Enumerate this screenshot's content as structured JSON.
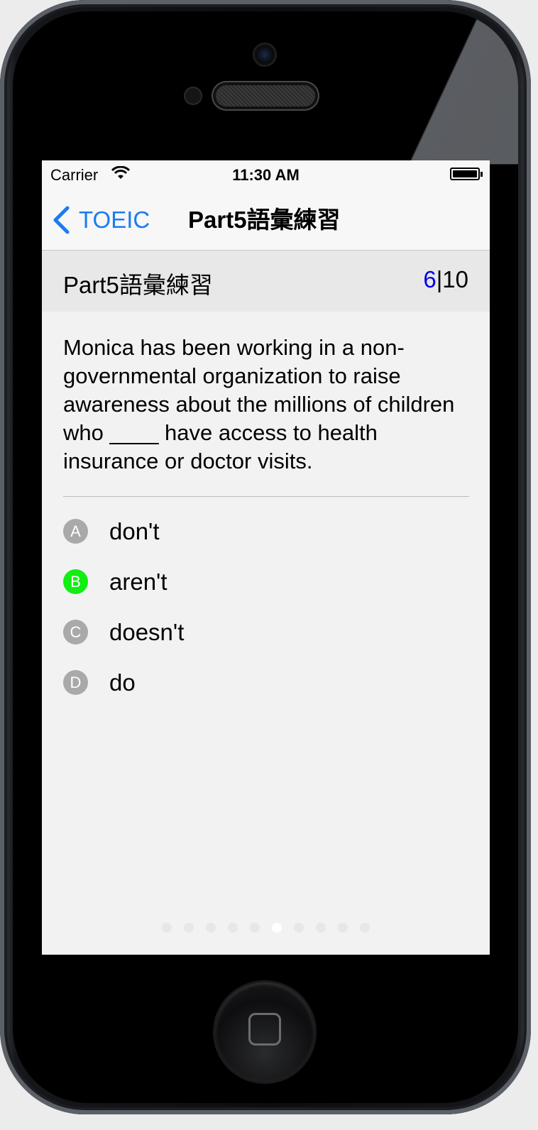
{
  "status_bar": {
    "carrier": "Carrier",
    "time": "11:30 AM"
  },
  "nav": {
    "back_label": "TOEIC",
    "title": "Part5語彙練習"
  },
  "header": {
    "label": "Part5語彙練習",
    "current": "6",
    "separator": "|",
    "total": "10"
  },
  "question": {
    "text": "Monica has been working in a non-governmental organization to raise awareness about the millions of children who ____ have access to health insurance or doctor visits."
  },
  "options": [
    {
      "letter": "A",
      "text": "don't",
      "selected": false
    },
    {
      "letter": "B",
      "text": "aren't",
      "selected": true
    },
    {
      "letter": "C",
      "text": "doesn't",
      "selected": false
    },
    {
      "letter": "D",
      "text": "do",
      "selected": false
    }
  ],
  "pager": {
    "total_pages": 10,
    "current_page": 6
  },
  "colors": {
    "accent": "#1a7cf2",
    "current_number": "#0000ee",
    "selected_badge": "#11ee11",
    "unselected_badge": "#a9a9a9"
  }
}
